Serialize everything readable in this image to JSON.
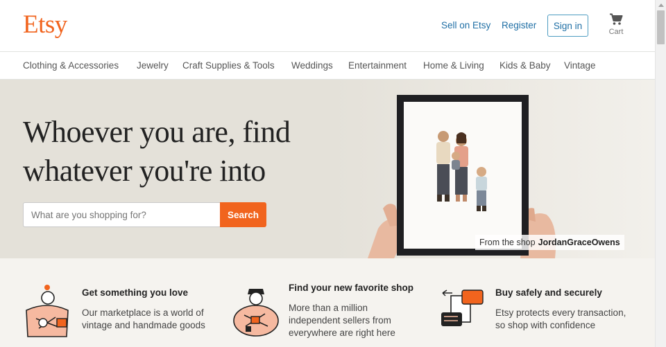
{
  "header": {
    "logo": "Etsy",
    "sell_label": "Sell on Etsy",
    "register_label": "Register",
    "signin_label": "Sign in",
    "cart_label": "Cart",
    "cart_icon": "cart-icon"
  },
  "nav": {
    "items": [
      {
        "label": "Clothing & Accessories"
      },
      {
        "label": "Jewelry"
      },
      {
        "label": "Craft Supplies & Tools"
      },
      {
        "label": "Weddings"
      },
      {
        "label": "Entertainment"
      },
      {
        "label": "Home & Living"
      },
      {
        "label": "Kids & Baby"
      },
      {
        "label": "Vintage"
      }
    ]
  },
  "hero": {
    "headline_line1": "Whoever you are, find",
    "headline_line2": "whatever you're into",
    "search_placeholder": "What are you shopping for?",
    "search_button": "Search",
    "credit_prefix": "From the shop",
    "credit_shop": "JordanGraceOwens"
  },
  "props": [
    {
      "title": "Get something you love",
      "text_line1": "Our marketplace is a world of",
      "text_line2": "vintage and handmade goods",
      "icon": "knitting-person-icon"
    },
    {
      "title": "Find your new favorite shop",
      "text_line1": "More than a million",
      "text_line2": "independent sellers from",
      "text_line3": "everywhere are right here",
      "icon": "artisan-person-icon"
    },
    {
      "title": "Buy safely and securely",
      "text_line1": "Etsy protects every transaction,",
      "text_line2": "so shop with confidence",
      "icon": "handshake-package-icon"
    }
  ],
  "colors": {
    "brand": "#f1641e",
    "link": "#1f6fa5",
    "hero_bg": "#e4e1d9",
    "props_bg": "#f5f3ef"
  }
}
